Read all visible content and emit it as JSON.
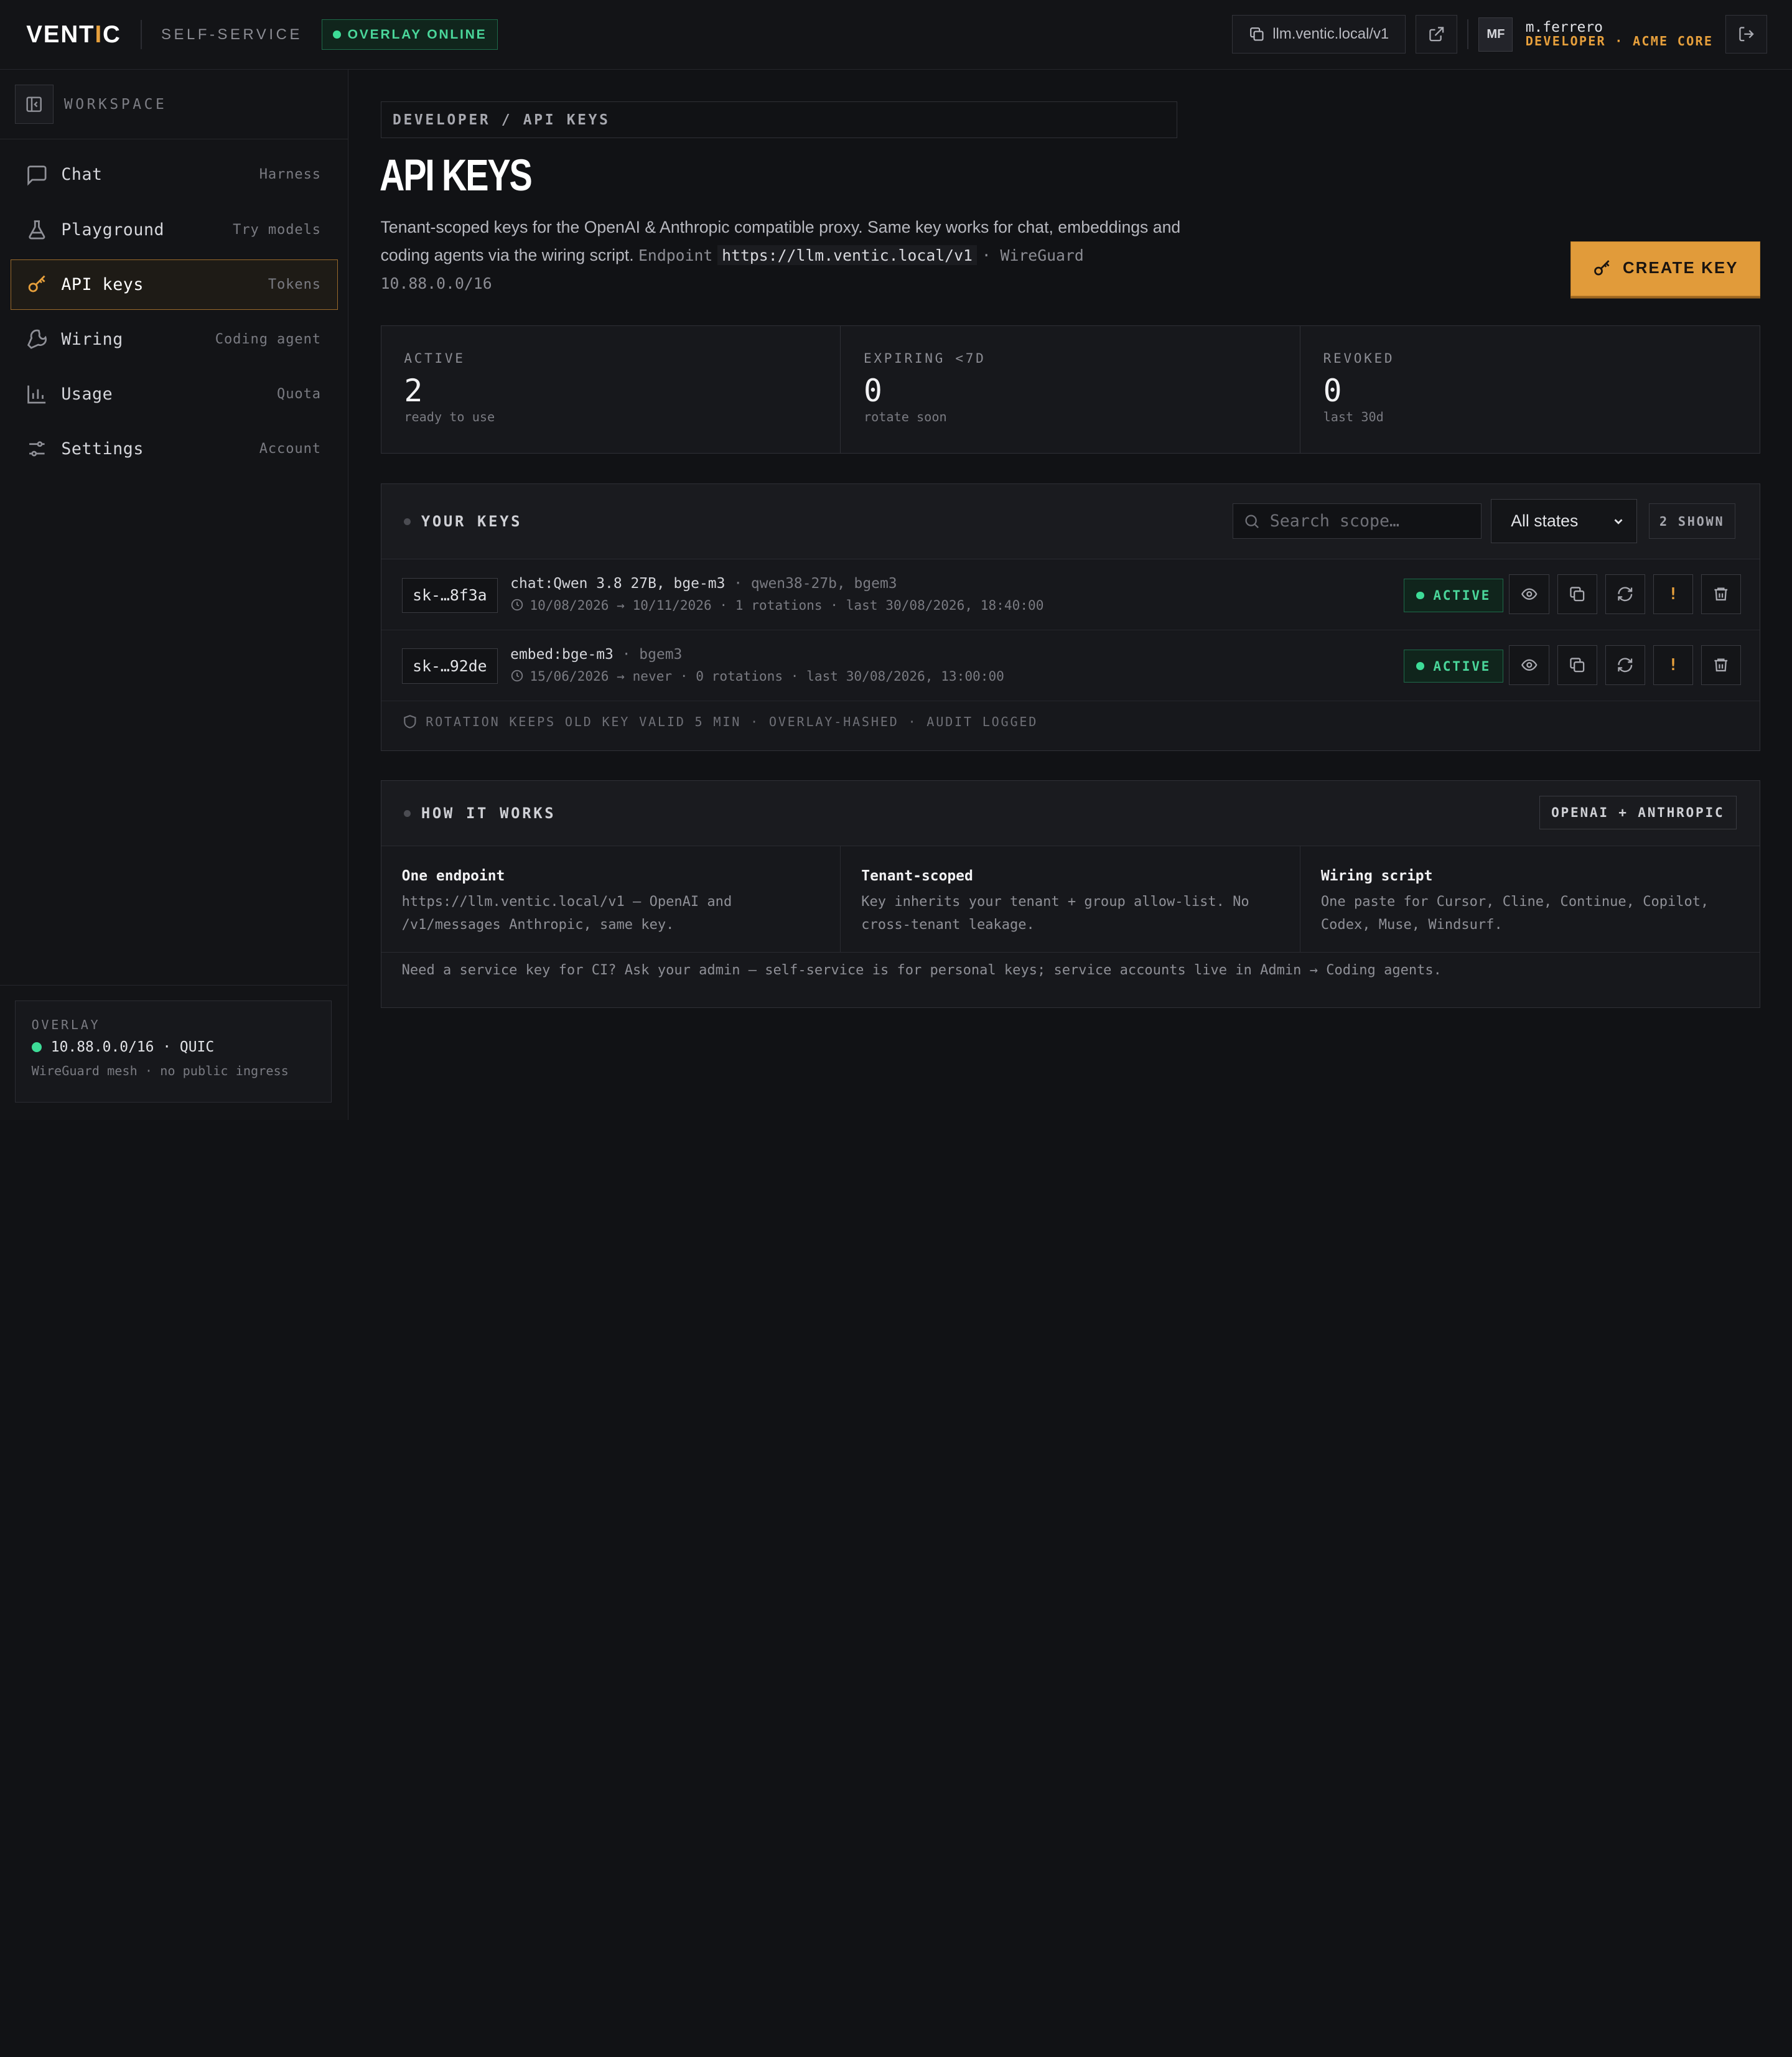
{
  "header": {
    "logo_main": "VENT",
    "logo_accent": "I",
    "logo_tail": "C",
    "section": "SELF-SERVICE",
    "overlay_status": "OVERLAY ONLINE",
    "endpoint": "llm.ventic.local/v1",
    "user_initials": "MF",
    "user_name": "m.ferrero",
    "user_role": "DEVELOPER · ACME CORE"
  },
  "sidebar": {
    "workspace_label": "WORKSPACE",
    "items": [
      {
        "label": "Chat",
        "hint": "Harness",
        "icon": "chat-icon",
        "active": false
      },
      {
        "label": "Playground",
        "hint": "Try models",
        "icon": "flask-icon",
        "active": false
      },
      {
        "label": "API keys",
        "hint": "Tokens",
        "icon": "key-icon",
        "active": true
      },
      {
        "label": "Wiring",
        "hint": "Coding agent",
        "icon": "wrench-icon",
        "active": false
      },
      {
        "label": "Usage",
        "hint": "Quota",
        "icon": "bar-chart-icon",
        "active": false
      },
      {
        "label": "Settings",
        "hint": "Account",
        "icon": "sliders-icon",
        "active": false
      }
    ],
    "overlay": {
      "title": "OVERLAY",
      "network": "10.88.0.0/16 · QUIC",
      "sub": "WireGuard mesh · no public ingress"
    }
  },
  "main": {
    "breadcrumb": "DEVELOPER / API KEYS",
    "title": "API KEYS",
    "intro_text": "Tenant-scoped keys for the OpenAI & Anthropic compatible proxy. Same key works for chat, embeddings and coding agents via the wiring script.",
    "intro_endpoint_label": "Endpoint",
    "intro_endpoint": "https://llm.ventic.local/v1",
    "intro_wireguard_label": "· WireGuard",
    "intro_wireguard": "10.88.0.0/16",
    "create_key": "CREATE KEY",
    "stats": [
      {
        "label": "ACTIVE",
        "value": "2",
        "sub": "ready to use"
      },
      {
        "label": "EXPIRING <7D",
        "value": "0",
        "sub": "rotate soon"
      },
      {
        "label": "REVOKED",
        "value": "0",
        "sub": "last 30d"
      }
    ],
    "keys_panel": {
      "title": "YOUR KEYS",
      "search_placeholder": "Search scope…",
      "state_filter": "All states",
      "shown": "2 SHOWN",
      "keys": [
        {
          "id": "sk-…8f3a",
          "scope": "chat:Qwen 3.8 27B, bge-m3",
          "models": "· qwen38-27b, bgem3",
          "meta": "10/08/2026 → 10/11/2026 · 1 rotations · last 30/08/2026, 18:40:00",
          "status": "ACTIVE"
        },
        {
          "id": "sk-…92de",
          "scope": "embed:bge-m3",
          "models": "· bgem3",
          "meta": "15/06/2026 → never · 0 rotations · last 30/08/2026, 13:00:00",
          "status": "ACTIVE"
        }
      ],
      "rotation_note": "ROTATION KEEPS OLD KEY VALID 5 MIN · OVERLAY-HASHED · AUDIT LOGGED"
    },
    "how_panel": {
      "title": "HOW IT WORKS",
      "badge": "OPENAI + ANTHROPIC",
      "cols": [
        {
          "title": "One endpoint",
          "text": "https://llm.ventic.local/v1 — OpenAI and /v1/messages Anthropic, same key."
        },
        {
          "title": "Tenant-scoped",
          "text": "Key inherits your tenant + group allow-list. No cross-tenant leakage."
        },
        {
          "title": "Wiring script",
          "text": "One paste for Cursor, Cline, Continue, Copilot, Codex, Muse, Windsurf."
        }
      ],
      "footer": "Need a service key for CI? Ask your admin — self-service is for personal keys; service accounts live in Admin → Coding agents."
    }
  },
  "colors": {
    "accent": "#e19b3a",
    "success": "#3ddc97",
    "background": "#111215"
  }
}
